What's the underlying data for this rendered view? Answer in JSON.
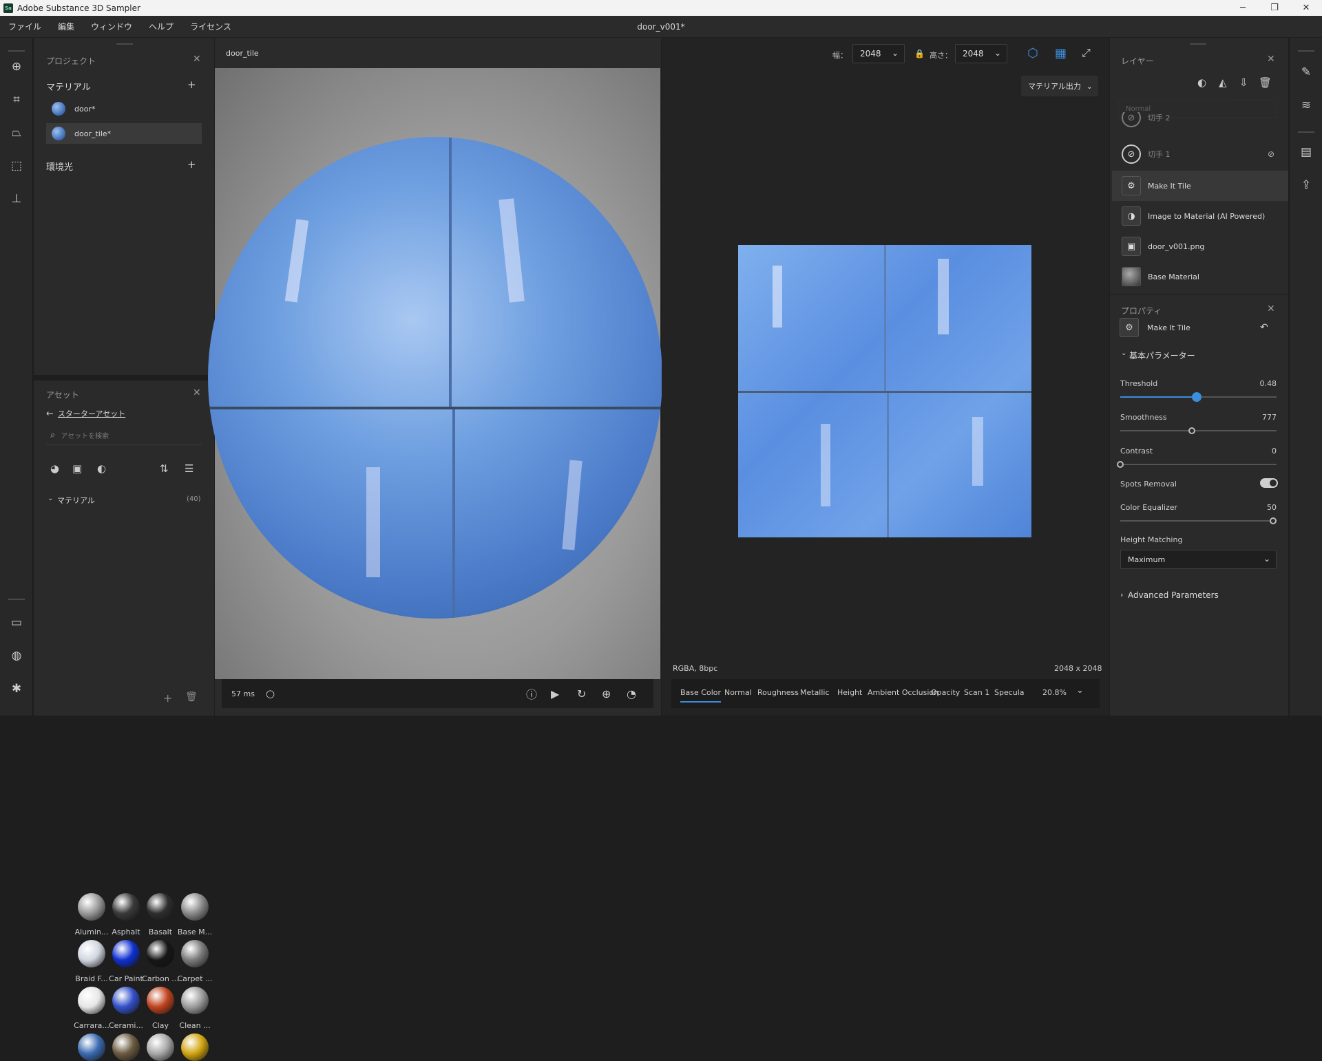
{
  "window": {
    "app_title": "Adobe Substance 3D Sampler",
    "logo_text": "Sa",
    "controls": [
      "─",
      "❐",
      "✕"
    ]
  },
  "menu": {
    "items": [
      "ファイル",
      "編集",
      "ウィンドウ",
      "ヘルプ",
      "ライセンス"
    ],
    "document_title": "door_v001*"
  },
  "project_panel": {
    "title": "プロジェクト",
    "materials_header": "マテリアル",
    "materials": [
      {
        "name": "door*",
        "selected": false
      },
      {
        "name": "door_tile*",
        "selected": true
      }
    ],
    "environment_header": "環境光",
    "add_symbol": "+"
  },
  "assets_panel": {
    "title": "アセット",
    "back_link": "スターターアセット",
    "search_placeholder": "アセットを検索",
    "section_label": "マテリアル",
    "section_count": "(40)",
    "items": [
      {
        "label": "Alumin...",
        "color": "#9a9a9a"
      },
      {
        "label": "Asphalt",
        "color": "#3a3a3a"
      },
      {
        "label": "Basalt",
        "color": "#2e2e2e"
      },
      {
        "label": "Base M...",
        "color": "#8a8a8a"
      },
      {
        "label": "Braid F...",
        "color": "#d0d6e0"
      },
      {
        "label": "Car Paint",
        "color": "#1030d0"
      },
      {
        "label": "Carbon ...",
        "color": "#161616"
      },
      {
        "label": "Carpet ...",
        "color": "#7a7a7a"
      },
      {
        "label": "Carrara...",
        "color": "#e6e6e6"
      },
      {
        "label": "Cerami...",
        "color": "#3450c8"
      },
      {
        "label": "Clay",
        "color": "#c0431e"
      },
      {
        "label": "Clean ...",
        "color": "#9c9c9c"
      },
      {
        "label": "",
        "color": "#3a6ab0"
      },
      {
        "label": "",
        "color": "#6a5a40"
      },
      {
        "label": "",
        "color": "#a8a8a8"
      },
      {
        "label": "",
        "color": "#d0a410"
      }
    ]
  },
  "viewport3d": {
    "tab_title": "door_tile",
    "render_time": "57 ms"
  },
  "viewport2d": {
    "width_label": "幅：",
    "width_value": "2048",
    "height_label": "高さ：",
    "height_value": "2048",
    "export_button": "マテリアル出力",
    "format_info": "RGBA, 8bpc",
    "resolution_info": "2048 x 2048",
    "channels": [
      "Base Color",
      "Normal",
      "Roughness",
      "Metallic",
      "Height",
      "Ambient Occlusion",
      "Opacity",
      "Scan 1",
      "Specula"
    ],
    "active_channel": "Base Color",
    "zoom": "20.8%"
  },
  "layers_panel": {
    "title": "レイヤー",
    "blend_mode": "Normal",
    "layers": [
      {
        "name": "切手 2",
        "icon": "slash-circle-icon",
        "hidden": true
      },
      {
        "name": "切手 1",
        "icon": "slash-circle-icon",
        "hidden": true
      },
      {
        "name": "Make It Tile",
        "icon": "tile-icon",
        "selected": true
      },
      {
        "name": "Image to Material (AI Powered)",
        "icon": "ai-image-icon"
      },
      {
        "name": "door_v001.png",
        "icon": "image-icon"
      },
      {
        "name": "Base Material",
        "icon": "sphere-icon"
      }
    ]
  },
  "properties_panel": {
    "title": "プロパティ",
    "filter_name": "Make It Tile",
    "section_basic": "基本パラメーター",
    "params": [
      {
        "label": "Threshold",
        "value": "0.48",
        "fraction": 0.48,
        "active": true
      },
      {
        "label": "Smoothness",
        "value": "777",
        "fraction": 0.46
      },
      {
        "label": "Contrast",
        "value": "0",
        "fraction": 0.0
      }
    ],
    "spots_removal_label": "Spots Removal",
    "spots_removal_on": true,
    "color_equalizer_label": "Color Equalizer",
    "color_equalizer_value": "50",
    "color_equalizer_fraction": 1.0,
    "height_matching_label": "Height Matching",
    "height_matching_value": "Maximum",
    "advanced_label": "Advanced Parameters"
  },
  "colors": {
    "accent": "#3b8ede",
    "material_blue": "#5b8fdc"
  }
}
